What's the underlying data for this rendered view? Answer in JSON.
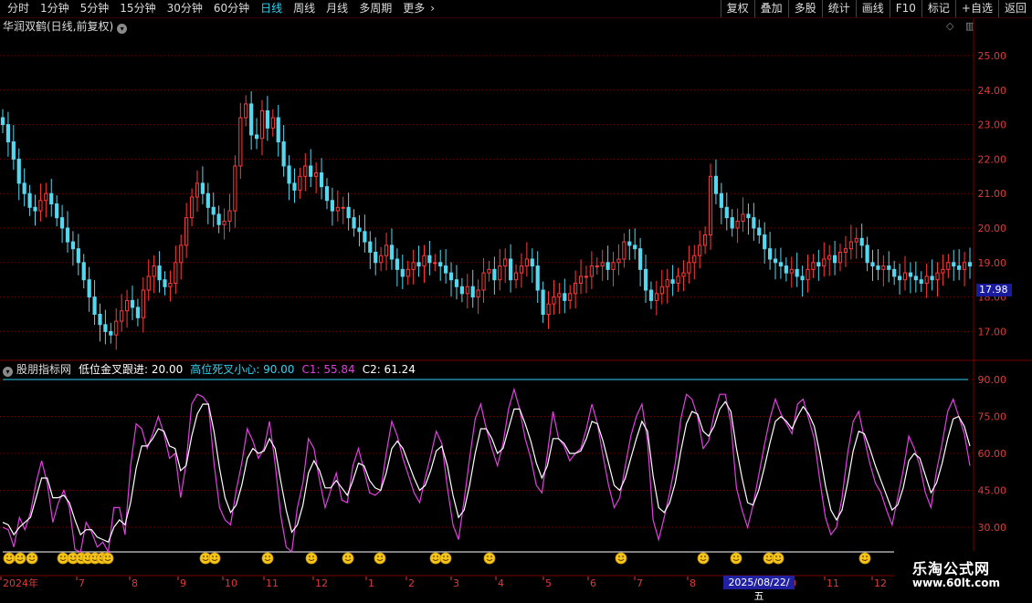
{
  "toolbar": {
    "periods": [
      {
        "label": "分时"
      },
      {
        "label": "1分钟"
      },
      {
        "label": "5分钟"
      },
      {
        "label": "15分钟"
      },
      {
        "label": "30分钟"
      },
      {
        "label": "60分钟"
      },
      {
        "label": "日线"
      },
      {
        "label": "周线"
      },
      {
        "label": "月线"
      },
      {
        "label": "多周期"
      },
      {
        "label": "更多"
      }
    ],
    "selected_period": "日线",
    "more_arrow": "›",
    "actions": [
      {
        "label": "复权"
      },
      {
        "label": "叠加"
      },
      {
        "label": "多股"
      },
      {
        "label": "统计"
      },
      {
        "label": "画线"
      },
      {
        "label": "F10"
      },
      {
        "label": "标记"
      },
      {
        "label": "+自选"
      },
      {
        "label": "返回"
      }
    ]
  },
  "main_chart": {
    "title": "华润双鹤(日线,前复权)",
    "current_price_tag": "17.98",
    "price_axis_labels": [
      "25.00",
      "24.00",
      "23.00",
      "22.00",
      "21.00",
      "20.00",
      "19.00",
      "18.00",
      "17.00"
    ]
  },
  "indicator": {
    "name": "股朋指标网",
    "items": [
      {
        "label": "低位金叉跟进:",
        "value": "20.00",
        "color": "#ffffff"
      },
      {
        "label": "高位死叉小心:",
        "value": "90.00",
        "color": "#2fd4f2"
      },
      {
        "label": "C1:",
        "value": "55.84",
        "color": "#e040e0"
      },
      {
        "label": "C2:",
        "value": "61.24",
        "color": "#ffffff"
      }
    ],
    "axis_labels": [
      "90.00",
      "75.00",
      "60.00",
      "45.00",
      "30.00"
    ]
  },
  "time_axis": {
    "labels": [
      {
        "text": "2024年"
      },
      {
        "text": "7"
      },
      {
        "text": "8"
      },
      {
        "text": "9"
      },
      {
        "text": "10"
      },
      {
        "text": "11"
      },
      {
        "text": "12"
      },
      {
        "text": "1"
      },
      {
        "text": "2"
      },
      {
        "text": "3"
      },
      {
        "text": "4"
      },
      {
        "text": "5"
      },
      {
        "text": "6"
      },
      {
        "text": "7"
      },
      {
        "text": "8"
      },
      {
        "text": "10"
      },
      {
        "text": "11"
      },
      {
        "text": "12"
      }
    ],
    "cursor_date": "2025/08/22/五"
  },
  "watermark": {
    "line1": "乐淘公式网",
    "line2": "www.60lt.com"
  },
  "colors": {
    "up": "#ff3b3b",
    "down": "#54d8f0",
    "grid": "#7a0000",
    "c1": "#e040e0",
    "c2": "#ffffff",
    "high_line": "#2fd4f2",
    "axis_text": "#dc3c3c"
  },
  "chart_data": {
    "type": "candlestick",
    "price_range": [
      16.5,
      26.0
    ],
    "closes": [
      23.0,
      22.5,
      22.0,
      21.3,
      21.0,
      20.6,
      20.5,
      20.8,
      21.0,
      20.7,
      20.3,
      20.0,
      19.6,
      19.4,
      19.0,
      18.5,
      18.0,
      17.5,
      17.2,
      17.0,
      16.9,
      17.3,
      17.6,
      17.9,
      17.7,
      17.4,
      18.2,
      18.6,
      18.9,
      18.5,
      18.3,
      18.4,
      19.0,
      19.5,
      20.3,
      20.9,
      21.3,
      21.0,
      20.6,
      20.4,
      20.1,
      20.2,
      20.5,
      21.8,
      23.2,
      23.6,
      22.7,
      22.6,
      23.4,
      22.9,
      23.2,
      22.5,
      21.8,
      21.3,
      21.1,
      21.5,
      21.8,
      21.5,
      21.6,
      21.2,
      20.8,
      20.5,
      20.6,
      20.6,
      20.3,
      20.0,
      19.9,
      19.6,
      19.3,
      19.0,
      19.2,
      19.5,
      19.1,
      18.8,
      18.6,
      18.8,
      19.0,
      18.9,
      19.2,
      19.0,
      19.0,
      18.9,
      18.7,
      18.5,
      18.3,
      18.1,
      18.3,
      18.0,
      18.2,
      18.7,
      18.8,
      18.5,
      18.9,
      19.1,
      18.5,
      18.7,
      18.9,
      19.1,
      18.9,
      18.2,
      17.5,
      17.8,
      18.0,
      18.1,
      17.9,
      18.1,
      18.4,
      18.6,
      18.6,
      18.9,
      18.9,
      19.0,
      18.8,
      19.0,
      19.1,
      19.6,
      19.5,
      19.4,
      18.8,
      18.2,
      17.9,
      18.1,
      18.3,
      18.5,
      18.4,
      18.6,
      18.7,
      19.0,
      19.2,
      19.5,
      19.8,
      21.5,
      21.0,
      20.6,
      20.3,
      20.0,
      20.2,
      20.4,
      20.3,
      20.0,
      19.8,
      19.4,
      19.1,
      19.0,
      18.9,
      18.7,
      18.8,
      18.6,
      18.5,
      18.8,
      19.0,
      18.9,
      19.1,
      19.2,
      19.0,
      19.3,
      19.4,
      19.6,
      19.7,
      19.5,
      19.0,
      18.9,
      18.8,
      18.9,
      18.8,
      18.6,
      18.5,
      18.7,
      18.6,
      18.5,
      18.4,
      18.6,
      18.5,
      18.7,
      18.8,
      19.0,
      18.9,
      18.8,
      19.0,
      18.9
    ],
    "c1": [
      30,
      29,
      22,
      34,
      29,
      36,
      48,
      57,
      48,
      32,
      40,
      45,
      38,
      21,
      20,
      32,
      28,
      22,
      24,
      20,
      38,
      38,
      27,
      55,
      72,
      70,
      62,
      68,
      75,
      68,
      58,
      60,
      42,
      56,
      80,
      84,
      83,
      80,
      56,
      38,
      33,
      31,
      45,
      56,
      70,
      65,
      58,
      62,
      73,
      56,
      35,
      22,
      20,
      38,
      48,
      66,
      62,
      49,
      38,
      45,
      52,
      41,
      40,
      55,
      62,
      53,
      44,
      43,
      45,
      60,
      73,
      67,
      58,
      51,
      44,
      40,
      50,
      59,
      69,
      64,
      46,
      31,
      25,
      41,
      58,
      74,
      80,
      70,
      62,
      55,
      64,
      78,
      86,
      78,
      66,
      58,
      47,
      44,
      60,
      77,
      66,
      63,
      57,
      60,
      62,
      70,
      80,
      72,
      59,
      47,
      38,
      42,
      55,
      67,
      75,
      80,
      65,
      33,
      25,
      34,
      44,
      56,
      74,
      84,
      82,
      75,
      62,
      65,
      76,
      84,
      84,
      72,
      46,
      37,
      30,
      39,
      51,
      63,
      74,
      82,
      76,
      72,
      68,
      80,
      82,
      74,
      66,
      49,
      34,
      27,
      30,
      42,
      60,
      73,
      77,
      66,
      56,
      48,
      44,
      37,
      31,
      42,
      53,
      67,
      62,
      55,
      44,
      38,
      53,
      64,
      77,
      82,
      75,
      68,
      55
    ],
    "c2": [
      32,
      31,
      27,
      30,
      32,
      34,
      42,
      50,
      50,
      42,
      42,
      43,
      40,
      33,
      27,
      29,
      29,
      26,
      25,
      24,
      30,
      33,
      31,
      40,
      54,
      63,
      63,
      66,
      70,
      69,
      63,
      62,
      53,
      55,
      67,
      76,
      80,
      80,
      69,
      54,
      42,
      36,
      39,
      47,
      58,
      62,
      60,
      61,
      66,
      62,
      49,
      37,
      28,
      31,
      39,
      52,
      57,
      53,
      46,
      46,
      49,
      46,
      43,
      49,
      56,
      55,
      49,
      46,
      45,
      52,
      62,
      65,
      62,
      56,
      50,
      45,
      47,
      53,
      61,
      63,
      55,
      43,
      34,
      37,
      47,
      60,
      70,
      70,
      66,
      60,
      62,
      70,
      78,
      78,
      72,
      65,
      56,
      50,
      55,
      66,
      66,
      64,
      60,
      60,
      61,
      66,
      73,
      72,
      65,
      56,
      47,
      45,
      50,
      58,
      66,
      73,
      69,
      51,
      38,
      36,
      40,
      48,
      61,
      72,
      77,
      76,
      69,
      67,
      71,
      78,
      81,
      77,
      62,
      50,
      40,
      39,
      45,
      54,
      64,
      73,
      75,
      73,
      70,
      75,
      79,
      76,
      71,
      60,
      47,
      37,
      33,
      37,
      48,
      61,
      69,
      68,
      62,
      55,
      49,
      43,
      37,
      39,
      46,
      57,
      60,
      58,
      51,
      44,
      48,
      56,
      66,
      74,
      75,
      71,
      63
    ]
  }
}
